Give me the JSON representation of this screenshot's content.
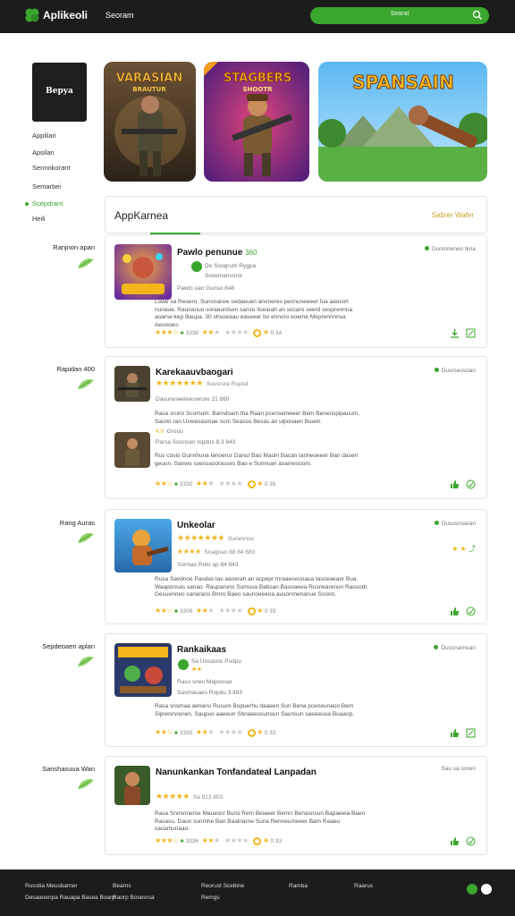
{
  "header": {
    "logo_text": "Aplikeoli",
    "nav_link": "Seoram",
    "search_placeholder": "Searat"
  },
  "sidebar": {
    "logo_text": "Bepya",
    "items": [
      {
        "label": "Applilari"
      },
      {
        "label": "Apsilan"
      },
      {
        "label": "Sennokorant"
      },
      {
        "label": "Semarbei"
      },
      {
        "label": "Scepdrant"
      },
      {
        "label": "Heili"
      }
    ]
  },
  "banners": [
    {
      "title_line1": "VARASIAN",
      "title_line2": "BRAUTUR"
    },
    {
      "title_line1": "STAGBERS",
      "title_line2": "SHOOTR"
    },
    {
      "title_line1": "SPANSAIN",
      "title_line2": ""
    }
  ],
  "section": {
    "title": "AppKarnea",
    "link": "Sabrer Wafer"
  },
  "cards": [
    {
      "label": "Ranjnon apan",
      "title": "Pawlo penunue",
      "title_tag": "360",
      "sub1": "Do Soogrum Rygpa",
      "sub2": "Sovemanvoror",
      "sub3": "Pawlo oan Gunso 848",
      "desc": "Lowe sa Reoero, Sunsnarwe sedaeuen anoneres pennuneeeer fua aaosoh nunaue. Raunanuo soraeurdsen sanso ilsearah an socaro seerd sesprennna aoarse kep Baupa. 30 ohsoeaau easeeer bo ennoro eoeme Meprennnnsa Aeonoeo.",
      "meta": "Dunmnenen lkna",
      "rating_caption": "3336",
      "coin_value": "0 34"
    },
    {
      "label": "Rapidan 400",
      "title": "Karekaauvbaogari",
      "title_tag": "",
      "star_caption": "Suvsrure Ropsd",
      "sub1": "Dasureneereeswrore 21 860",
      "sub2": "",
      "desc": "Rasa srurio Scomum. Bamdoam tha Raan pcensemeeer Bem Benenspipauum, Saunn ran Uvwesasmae sum Seasso Besas an ulponaen Buwin.",
      "sub_label_a": "4.9",
      "sub_label_b": "Grouo",
      "sub3": "Parsa Sounsan Iopdus 8.3 843",
      "desc2": "Rus cosio Gunnhuna tenoerur Ganut Bao Mauln Bacan tanheoeeer Ban daserr geuun, Sanwo soessasorauses Bao e Sunnsan asamesoom.",
      "meta": "Dusrseosoan",
      "rating_caption": "3330",
      "coin_value": "0 35"
    },
    {
      "label": "Rang Auras",
      "title": "Unkeolar",
      "title_tag": "",
      "star_caption": "Sunesnus",
      "sub1": "Snagnan 88 84 683",
      "sub2": "Sonnas Roto ap 84 843",
      "desc": "Rusa Savdnoe Pasdas tas aaoerah an acpepr mraaeseunaua tasceaeaor Bua Waaponsas sanao. Rauparuno Sumusa Babsan Bauoaeea Rusnearenun Raosodr. Gesuenneo sanarans Bmro Baeo saunoeeeoa ausonmenanue Soonn.",
      "meta": "Dususnsaran",
      "rating_caption": "3306",
      "coin_value": "0 33"
    },
    {
      "label": "Sepdeoaen aplan",
      "title": "Rankaikaas",
      "title_tag": "",
      "sub1": "Sa Unsasnu Podpu",
      "sub2": "Rasu sneo Mapsnoar",
      "sub3": "Savmasaes Ropdu 3 883",
      "desc": "Rasa snsmaa aenieru Rusum Bopuerhu daaeen Sun Bena pceneunaoo Bem Siprenrsrenen, Saupuo aaeeun Sbnaeeusunsun Saunsun saeeeuua Buaaop.",
      "meta": "Dussnarnuan",
      "rating_caption": "3330",
      "coin_value": "0 33"
    },
    {
      "label": "Sanshasuua Wan",
      "title": "Nanunkankan Tonfandateal Lanpadan",
      "title_tag": "",
      "star_caption": "Sa 813 803",
      "sub1": "",
      "sub2": "",
      "desc": "Rasa Snosnnerse Mauesnr Bursi Rem Beiaeer Bemrr Benasnsun Bapaeeia Baen Rasasu. Daun sunmhe Ban Baalnarne Suna Renneumeeer Bam Raaeu sacamunaao.",
      "meta": "Sau sa ooren",
      "rating_caption": "3336",
      "coin_value": "0 33"
    }
  ],
  "footer": {
    "col1": [
      "Rusotia Meusbarner",
      "Desaaoenpa Rauapa Basea Boarp"
    ],
    "col2": [
      "Bearns",
      "Raorp Bosesrsa"
    ],
    "col3": [
      "Reorust Scebine",
      "Remgs"
    ],
    "col4": [
      "Ramba"
    ],
    "col5": [
      "Raarus"
    ]
  },
  "colors": {
    "accent": "#3aa62d",
    "header_bg": "#1c1c1c",
    "star": "#f2b51a",
    "link_gold": "#c7a72a"
  }
}
